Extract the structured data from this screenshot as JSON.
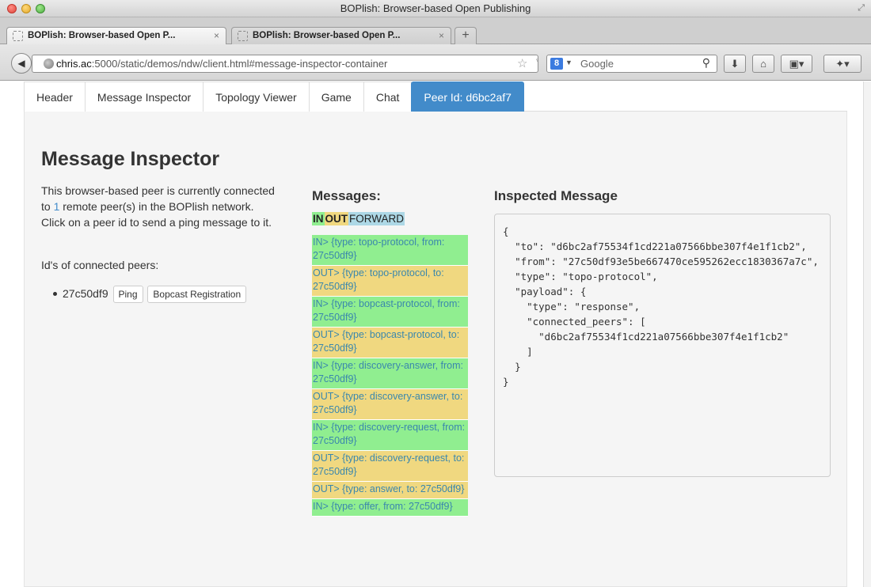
{
  "window": {
    "title": "BOPlish: Browser-based Open Publishing"
  },
  "browser": {
    "tabs": [
      {
        "label": "BOPlish: Browser-based Open P...",
        "close": "×"
      },
      {
        "label": "BOPlish: Browser-based Open P...",
        "close": "×"
      }
    ],
    "new_tab": "+",
    "url_host": "chris.ac",
    "url_rest": ":5000/static/demos/ndw/client.html#message-inspector-container",
    "search_placeholder": "Google",
    "search_engine": "8"
  },
  "nav": {
    "tabs": [
      "Header",
      "Message Inspector",
      "Topology Viewer",
      "Game",
      "Chat"
    ],
    "peer_label": "Peer Id: d6bc2af7"
  },
  "inspector": {
    "title": "Message Inspector",
    "intro_before": "This browser-based peer is currently connected to ",
    "peer_count": "1",
    "intro_after": " remote peer(s) in the BOPlish network. Click on a peer id to send a ping message to it.",
    "peers_label": "Id's of connected peers:",
    "peers": [
      {
        "id": "27c50df9",
        "ping_label": "Ping",
        "register_label": "Bopcast Registration"
      }
    ]
  },
  "messages": {
    "heading": "Messages:",
    "legend": {
      "in": "IN",
      "out": "OUT",
      "forward": "FORWARD"
    },
    "colors": {
      "in": "#90ee90",
      "out": "#f0d880",
      "forward": "#add8e6",
      "text": "#3a87ad"
    },
    "items": [
      {
        "dir": "in",
        "text": "IN> {type: topo-protocol, from: 27c50df9}"
      },
      {
        "dir": "out",
        "text": "OUT> {type: topo-protocol, to: 27c50df9}"
      },
      {
        "dir": "in",
        "text": "IN> {type: bopcast-protocol, from: 27c50df9}"
      },
      {
        "dir": "out",
        "text": "OUT> {type: bopcast-protocol, to: 27c50df9}"
      },
      {
        "dir": "in",
        "text": "IN> {type: discovery-answer, from: 27c50df9}"
      },
      {
        "dir": "out",
        "text": "OUT> {type: discovery-answer, to: 27c50df9}"
      },
      {
        "dir": "in",
        "text": "IN> {type: discovery-request, from: 27c50df9}"
      },
      {
        "dir": "out",
        "text": "OUT> {type: discovery-request, to: 27c50df9}"
      },
      {
        "dir": "out",
        "text": "OUT> {type: answer, to: 27c50df9}"
      },
      {
        "dir": "in",
        "text": "IN> {type: offer, from: 27c50df9}"
      }
    ]
  },
  "inspected": {
    "heading": "Inspected Message",
    "json_text": "{\n  \"to\": \"d6bc2af75534f1cd221a07566bbe307f4e1f1cb2\",\n  \"from\": \"27c50df93e5be667470ce595262ecc1830367a7c\",\n  \"type\": \"topo-protocol\",\n  \"payload\": {\n    \"type\": \"response\",\n    \"connected_peers\": [\n      \"d6bc2af75534f1cd221a07566bbe307f4e1f1cb2\"\n    ]\n  }\n}"
  }
}
